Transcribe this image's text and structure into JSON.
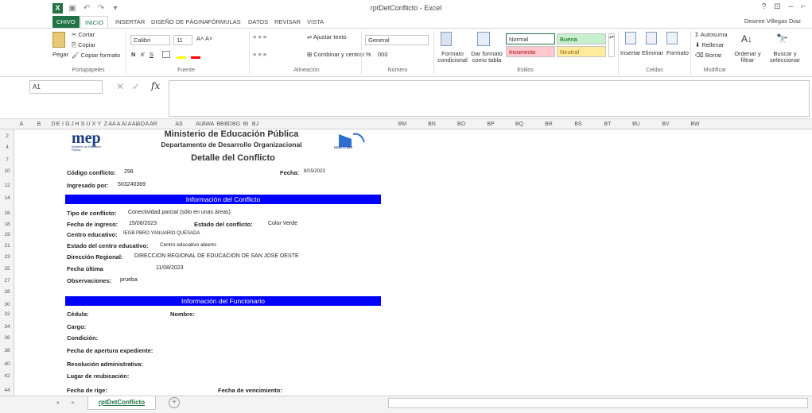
{
  "window": {
    "title": "rptDetConflicto - Excel",
    "user": "Desiree Villegas Diaz"
  },
  "window_controls": [
    "?",
    "⊡",
    "–",
    "⌐"
  ],
  "ribbon_tabs": [
    {
      "label": "CHIVO"
    },
    {
      "label": "INICIO"
    },
    {
      "label": "INSERTAR"
    },
    {
      "label": "DISEÑO DE PÁGINA"
    },
    {
      "label": "FÓRMULAS"
    },
    {
      "label": "DATOS"
    },
    {
      "label": "REVISAR"
    },
    {
      "label": "VISTA"
    }
  ],
  "ribbon": {
    "clipboard": {
      "paste": "Pegar",
      "cut": "Cortar",
      "copy": "Copiar",
      "format_painter": "Copiar formato",
      "label": "Portapapeles"
    },
    "font": {
      "name": "Calibri",
      "size": "11",
      "label": "Fuente",
      "bold": "N",
      "italic": "K",
      "underline": "S"
    },
    "alignment": {
      "wrap": "Ajustar texto",
      "merge": "Combinar y centrar",
      "label": "Alineación"
    },
    "number": {
      "format": "General",
      "label": "Número",
      "percent": "%",
      "thousands": "000"
    },
    "styles": {
      "conditional": "Formato condicional",
      "as_table": "Dar formato como tabla",
      "normal": "Normal",
      "good": "Buena",
      "bad": "Incorrecto",
      "neutral": "Neutral",
      "label": "Estilos"
    },
    "cells": {
      "insert": "Insertar",
      "delete": "Eliminar",
      "format": "Formato",
      "label": "Celdas"
    },
    "editing": {
      "autosum": "Autosuma",
      "fill": "Rellenar",
      "clear": "Borrar",
      "sort": "Ordenar y filtrar",
      "find": "Buscar y seleccionar",
      "label": "Modificar"
    }
  },
  "formula_bar": {
    "name_box": "A1",
    "fx": "fx",
    "value": ""
  },
  "columns": [
    "A",
    "B",
    "D",
    "E",
    "I",
    "G",
    "J",
    "H",
    "S",
    "U",
    "X",
    "Y",
    "Z",
    "AA",
    "A",
    "AI",
    "A",
    "AL",
    "AO",
    "A",
    "AR",
    "AS",
    "AU",
    "AW",
    "A",
    "BB",
    "BD",
    "BG",
    "BI",
    "BJ",
    "BM",
    "BN",
    "BO",
    "BP",
    "BQ",
    "BR",
    "BS",
    "BT",
    "BU",
    "BV",
    "BW"
  ],
  "rows": [
    "2",
    "4",
    "7",
    "10",
    "12",
    "14",
    "16",
    "18",
    "19",
    "21",
    "23",
    "25",
    "27",
    "28",
    "30",
    "32",
    "34",
    "36",
    "38",
    "40",
    "42",
    "44"
  ],
  "report": {
    "logo_text": "mep",
    "logo_sub": "Ministerio de Educación Pública",
    "logo_right": "DIDISCO-MEP",
    "ministry": "Ministerio de Educación Pública",
    "department": "Departamento de Desarrollo Organizacional",
    "heading": "Detalle del Conflicto",
    "conflict_code_label": "Código conflicto:",
    "conflict_code": "298",
    "date_label": "Fecha:",
    "date": "8/15/2023",
    "entered_by_label": "Ingresado por:",
    "entered_by": "503240369",
    "section1": "Información del Conflicto",
    "type_label": "Tipo de conflicto:",
    "type": "Conectividad parcial (sólo en unas áreas)",
    "entry_date_label": "Fecha de ingreso:",
    "entry_date": "15/06/2023",
    "status_label": "Estado del conflicto:",
    "status": "Color Verde",
    "center_label": "Centro educativo:",
    "center": "IEGB PBRO YANUARIO QUESADA",
    "center_status_label": "Estado del centro educativo:",
    "center_status": "Centro educativo abierto",
    "region_label": "Dirección Regional:",
    "region": "DIRECCION REGIONAL DE EDUCACION DE SAN JOSE OESTE",
    "last_date_label": "Fecha última",
    "last_date": "11/08/2023",
    "obs_label": "Observaciones:",
    "obs": "prueba",
    "section2": "Información del Funcionario",
    "id_label": "Cédula:",
    "name_label": "Nombre:",
    "position_label": "Cargo:",
    "condition_label": "Condición:",
    "file_open_label": "Fecha de apertura expediente:",
    "admin_res_label": "Resolución administrativa:",
    "relocation_label": "Lugar de reubicación:",
    "effective_label": "Fecha de rige:",
    "expiry_label": "Fecha de vencimiento:"
  },
  "sheet_tab": "rptDetConflicto",
  "colors": {
    "excel_green": "#217346",
    "section_bar": "#0000ff",
    "arrow": "#e9731f"
  }
}
